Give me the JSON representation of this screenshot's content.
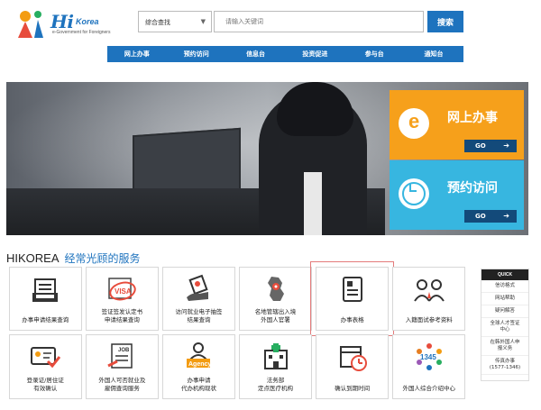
{
  "header": {
    "logo_text": "Hi",
    "logo_korea": "Korea",
    "logo_subtitle": "e-Government for Foreigners",
    "search_select_value": "综合查找",
    "search_placeholder": "请输入关键词",
    "search_button": "搜索"
  },
  "nav": {
    "items": [
      "网上办事",
      "预约访问",
      "信息台",
      "投资促进",
      "参与台",
      "通知台"
    ]
  },
  "banner": {
    "tile1_title": "网上办事",
    "tile1_go": "GO",
    "tile2_title": "预约访问",
    "tile2_go": "GO",
    "slide_count": 9
  },
  "services": {
    "title": "HIKOREA",
    "subtitle": "经常光顾的服务",
    "items": [
      {
        "label": "办事申请结果查询",
        "icon": "document-list-icon"
      },
      {
        "label": "签证签发认定书\n申请结果查询",
        "icon": "visa-stamp-icon"
      },
      {
        "label": "访问就业电子抽签\n结果查询",
        "icon": "hand-ticket-icon"
      },
      {
        "label": "名地管辖出入境\n外国人官署",
        "icon": "korea-map-pin-icon"
      },
      {
        "label": "办事表格",
        "icon": "form-document-icon"
      },
      {
        "label": "入籍面试参考资料",
        "icon": "interview-people-icon"
      },
      {
        "label": "登录证/居住证\n有效确认",
        "icon": "id-card-check-icon"
      },
      {
        "label": "外国人可否就业及\n雇佣查询服务",
        "icon": "job-search-icon"
      },
      {
        "label": "办事申请\n代办机构现状",
        "icon": "agency-person-icon"
      },
      {
        "label": "法务部\n定点医疗机构",
        "icon": "hospital-icon"
      },
      {
        "label": "确认到期时间",
        "icon": "calendar-clock-icon"
      },
      {
        "label": "外国人综合介绍中心",
        "icon": "call-center-1345-icon"
      }
    ]
  },
  "quick": {
    "head": "QUICK",
    "items": [
      "信访格式",
      "网站帮助",
      "疑问解答",
      "全球人才签证\n中心",
      "在韩外国人申\n报义务",
      "传真办事\n(1577-1346)"
    ]
  },
  "colors": {
    "brand_blue": "#1e73be",
    "orange": "#f6a01b",
    "cyan": "#37b6e0",
    "highlight": "#e37b7b"
  }
}
